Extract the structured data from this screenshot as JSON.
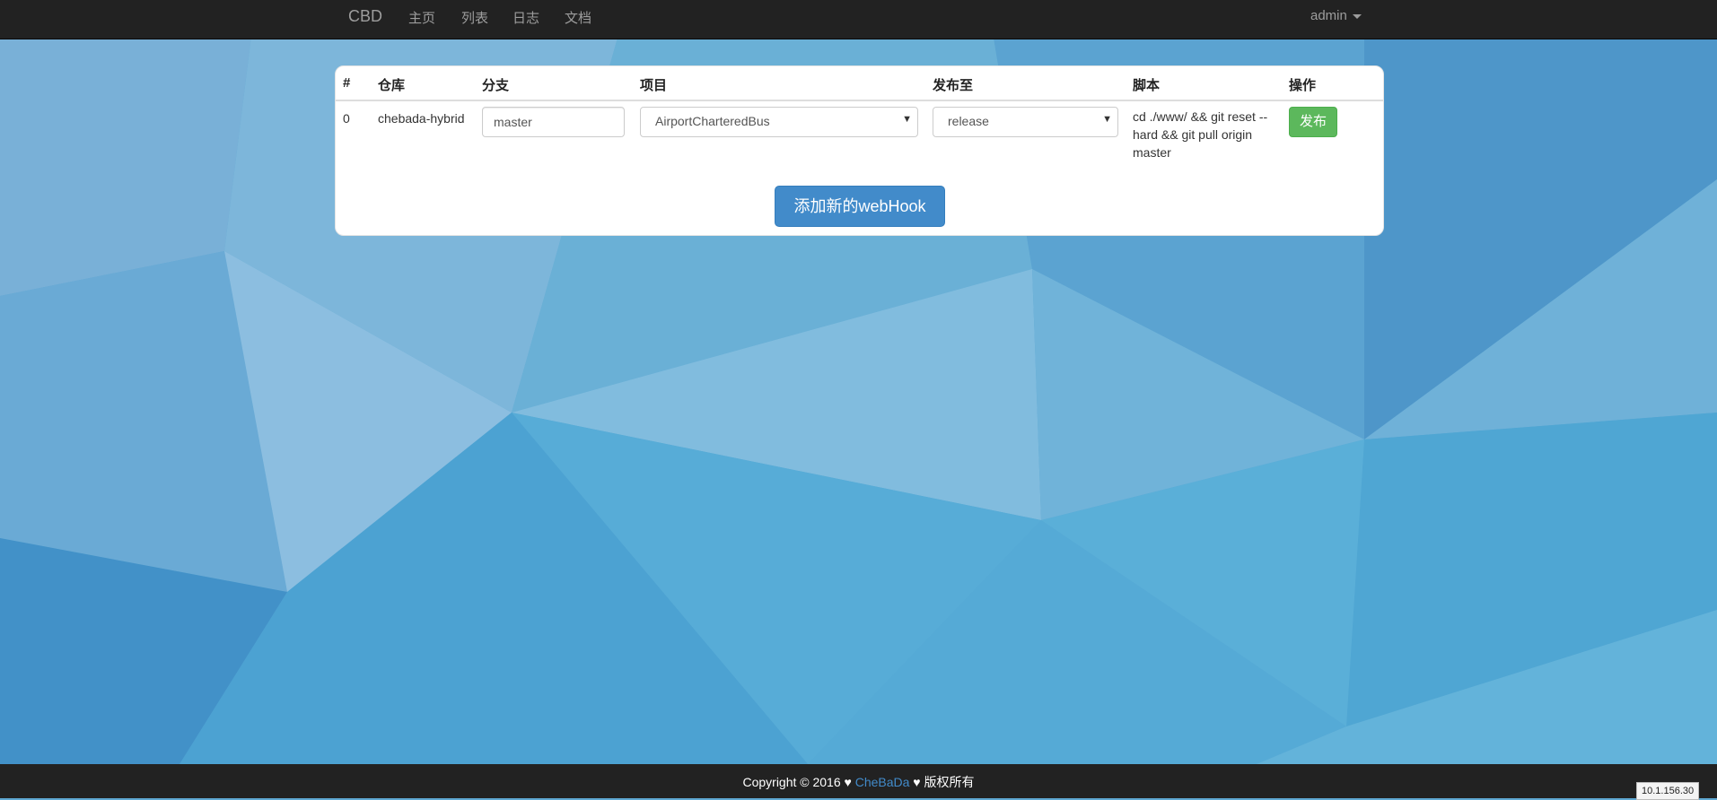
{
  "navbar": {
    "brand": "CBD",
    "links": [
      "主页",
      "列表",
      "日志",
      "文档"
    ],
    "user": "admin"
  },
  "table": {
    "headers": [
      "#",
      "仓库",
      "分支",
      "项目",
      "发布至",
      "脚本",
      "操作"
    ],
    "rows": [
      {
        "index": "0",
        "repo": "chebada-hybrid",
        "branch": "master",
        "project": "AirportCharteredBus",
        "target": "release",
        "script": "cd ./www/ && git reset --hard && git pull origin master",
        "action_label": "发布"
      }
    ]
  },
  "add_button": "添加新的webHook",
  "footer": {
    "copyright_prefix": "Copyright © 2016 ♥ ",
    "brand": "CheBaDa",
    "copyright_suffix": " ♥ 版权所有"
  },
  "ip_badge": "10.1.156.30",
  "colors": {
    "navbar_bg": "#222222",
    "publish_button": "#5cb85c",
    "primary_button": "#428bca",
    "footer_link": "#428bca"
  }
}
